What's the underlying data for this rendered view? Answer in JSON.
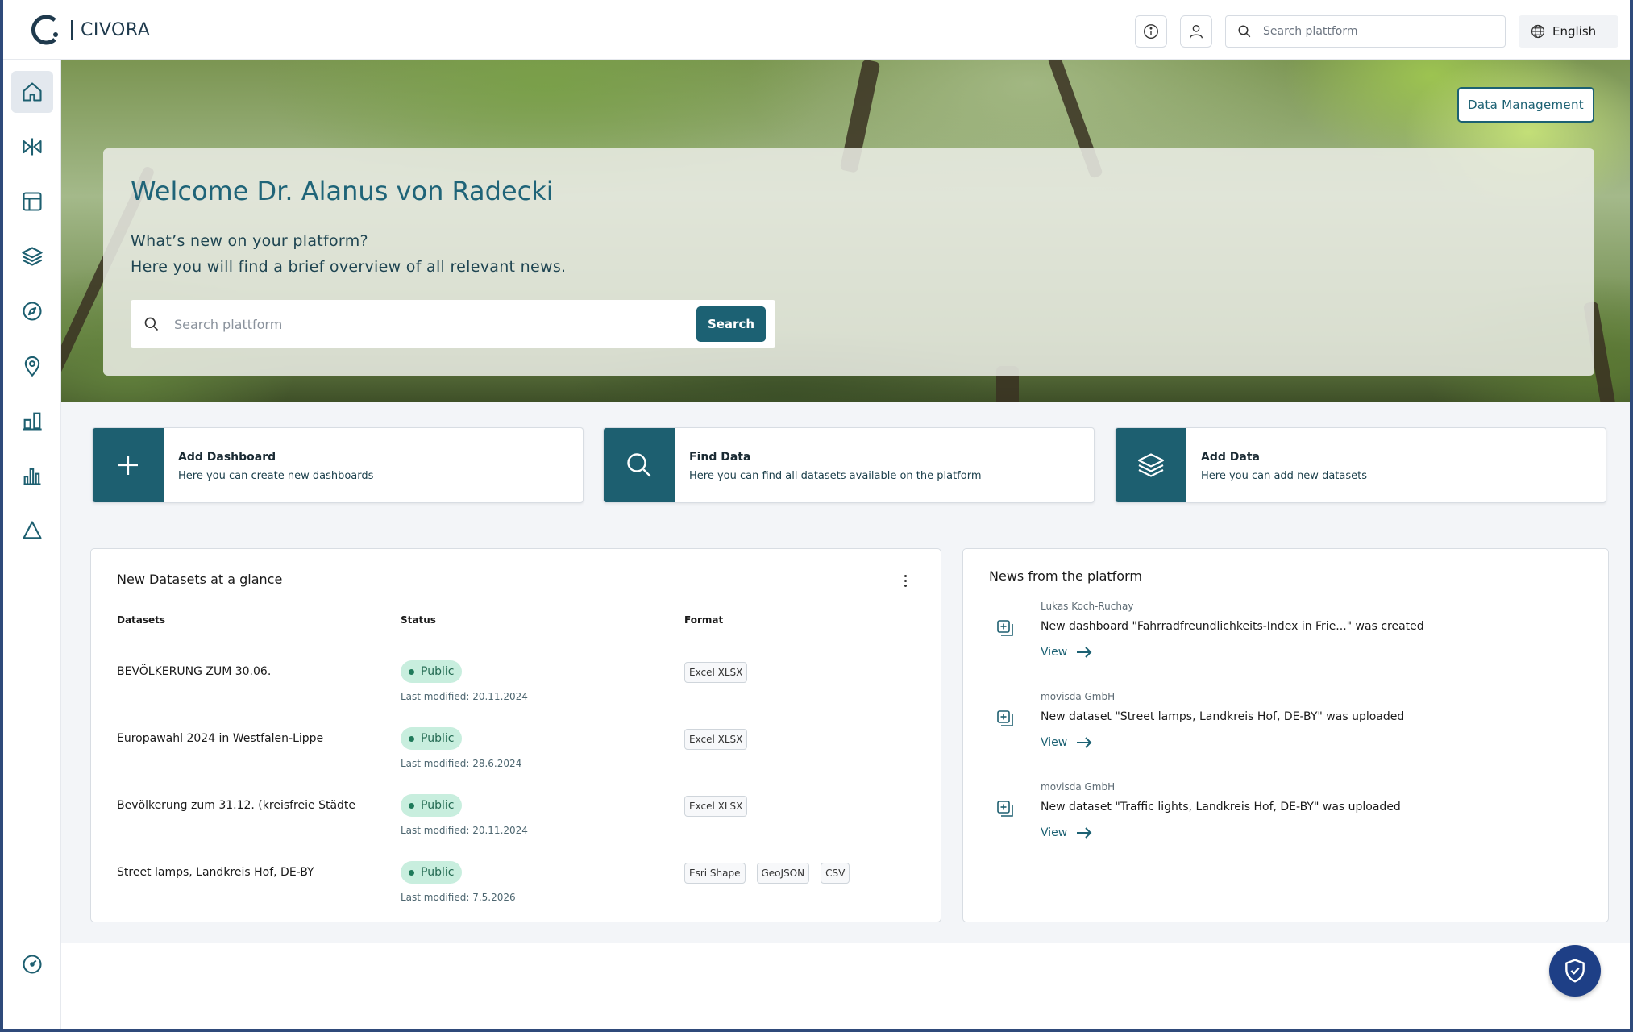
{
  "brand": {
    "name": "CIVORA"
  },
  "header": {
    "search_placeholder": "Search plattform",
    "language": "English"
  },
  "sidebar": {
    "items": [
      {
        "icon": "home-icon",
        "active": true
      },
      {
        "icon": "split-icon",
        "active": false
      },
      {
        "icon": "layout-icon",
        "active": false
      },
      {
        "icon": "layers-icon",
        "active": false
      },
      {
        "icon": "compass-icon",
        "active": false
      },
      {
        "icon": "map-pin-icon",
        "active": false
      },
      {
        "icon": "bar-chart-icon",
        "active": false
      },
      {
        "icon": "column-chart-icon",
        "active": false
      },
      {
        "icon": "triangle-icon",
        "active": false
      },
      {
        "icon": "gauge-icon",
        "active": false
      }
    ]
  },
  "hero": {
    "title": "Welcome Dr. Alanus von Radecki",
    "subtitle_line1": "What’s new on your platform?",
    "subtitle_line2": "Here you will find a brief overview of all relevant news.",
    "search_placeholder": "Search plattform",
    "search_button": "Search",
    "data_management_button": "Data Management"
  },
  "quick_actions": [
    {
      "icon": "plus-icon",
      "title": "Add Dashboard",
      "description": "Here you can create new dashboards"
    },
    {
      "icon": "search-icon",
      "title": "Find Data",
      "description": "Here you can find all datasets available on the platform"
    },
    {
      "icon": "layers-icon",
      "title": "Add Data",
      "description": "Here you can add new datasets"
    }
  ],
  "datasets_panel": {
    "title": "New Datasets at a glance",
    "columns": {
      "datasets": "Datasets",
      "status": "Status",
      "format": "Format"
    },
    "rows": [
      {
        "name": "BEVÖLKERUNG ZUM 30.06.",
        "status": "Public",
        "modified": "Last modified: 20.11.2024",
        "formats": [
          "Excel XLSX"
        ]
      },
      {
        "name": "Europawahl 2024 in Westfalen-Lippe",
        "status": "Public",
        "modified": "Last modified: 28.6.2024",
        "formats": [
          "Excel XLSX"
        ]
      },
      {
        "name": "Bevölkerung zum 31.12. (kreisfreie Städte",
        "status": "Public",
        "modified": "Last modified: 20.11.2024",
        "formats": [
          "Excel XLSX"
        ]
      },
      {
        "name": "Street lamps, Landkreis Hof, DE-BY",
        "status": "Public",
        "modified": "Last modified: 7.5.2026",
        "formats": [
          "Esri Shape",
          "GeoJSON",
          "CSV"
        ]
      }
    ]
  },
  "news_panel": {
    "title": "News from the platform",
    "items": [
      {
        "author": "Lukas Koch-Ruchay",
        "text": "New dashboard \"Fahrradfreundlichkeits-Index in Frie...\" was created",
        "link": "View"
      },
      {
        "author": "movisda GmbH",
        "text": "New dataset \"Street lamps, Landkreis Hof, DE-BY\" was uploaded",
        "link": "View"
      },
      {
        "author": "movisda GmbH",
        "text": "New dataset \"Traffic lights, Landkreis Hof, DE-BY\" was uploaded",
        "link": "View"
      }
    ]
  },
  "colors": {
    "primary": "#1c6173",
    "accent_dark": "#1d5f70",
    "badge_bg": "#c8eede",
    "shield_button": "#1e3f86"
  }
}
